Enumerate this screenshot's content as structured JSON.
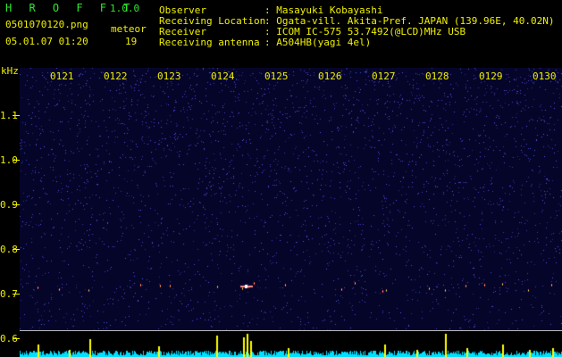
{
  "header": {
    "app_title": "H R O F F T",
    "version": "1.0.0",
    "filename": "0501070120.png",
    "datetime": "05.01.07 01:20",
    "meteor_label": "meteor",
    "meteor_count": "19",
    "info_labels": [
      "Observer",
      "Receiving Location",
      "Receiver",
      "Receiving antenna"
    ],
    "info_values": [
      ": Masayuki Kobayashi",
      ": Ogata-vill. Akita-Pref. JAPAN (139.96E, 40.02N)",
      ": ICOM IC-575 53.7492(@LCD)MHz USB",
      ": A504HB(yagi 4el)"
    ]
  },
  "axis": {
    "unit": "kHz",
    "y_ticks": [
      "1.1",
      "1.0",
      "0.9",
      "0.8",
      "0.7",
      "0.6"
    ],
    "x_ticks": [
      "0121",
      "0122",
      "0123",
      "0124",
      "0125",
      "0126",
      "0127",
      "0128",
      "0129",
      "0130"
    ]
  },
  "colors": {
    "header_green": "#2ee82e",
    "label_yellow": "#f0f000",
    "plot_background": "#05052a",
    "noise_blue": "#3333cc",
    "spectrum_cyan": "#00ffff"
  }
}
